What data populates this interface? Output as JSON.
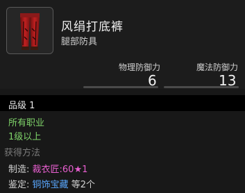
{
  "item": {
    "name": "风绢打底裤",
    "type": "腿部防具"
  },
  "stats": {
    "physical_label": "物理防御力",
    "physical_value": "6",
    "magic_label": "魔法防御力",
    "magic_value": "13"
  },
  "grade": {
    "label": "品级 1"
  },
  "requirements": {
    "class": "所有职业",
    "level": "1级以上"
  },
  "acquire": {
    "title": "获得方法",
    "craft_label": "制造:",
    "craft_value": "裁衣匠:60★1",
    "appraise_label": "鉴定:",
    "appraise_value": "铜饰宝藏",
    "appraise_suffix": "等2个"
  },
  "colors": {
    "requirement_green": "#7fd46a",
    "craft_pink": "#e85fd0",
    "appraise_blue": "#5aa8ff",
    "grade_bar": "#000000"
  },
  "icons": {
    "item": "red-trousers-icon"
  }
}
